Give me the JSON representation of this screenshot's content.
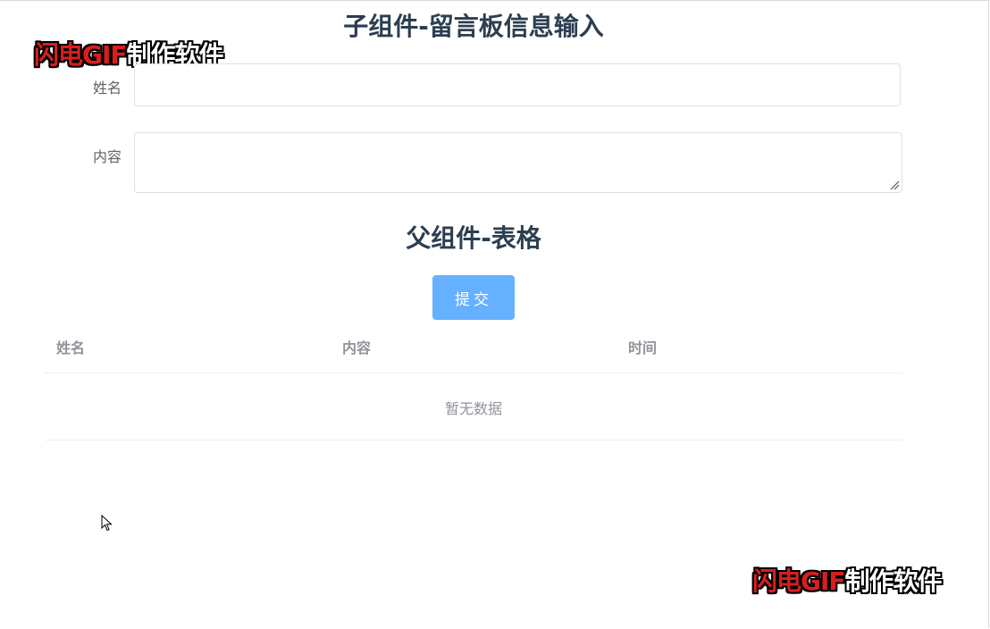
{
  "child_section": {
    "title": "子组件-留言板信息输入",
    "name_label": "姓名",
    "name_value": "",
    "content_label": "内容",
    "content_value": ""
  },
  "parent_section": {
    "title": "父组件-表格",
    "submit_label": "提交",
    "table": {
      "columns": [
        "姓名",
        "内容",
        "时间"
      ],
      "rows": [],
      "empty_text": "暂无数据"
    }
  },
  "watermark": {
    "red_text": "闪电GIF",
    "white_text": "制作软件"
  },
  "colors": {
    "title": "#2c3e50",
    "button": "#66b1ff",
    "border": "#dcdfe6",
    "header_text": "#909399"
  }
}
